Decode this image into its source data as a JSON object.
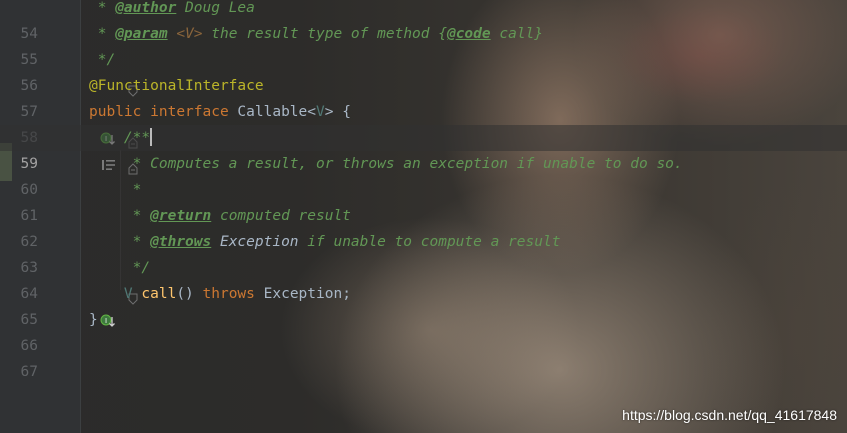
{
  "editor": {
    "lines": [
      {
        "number": "54",
        "indent": " ",
        "parts": {
          "p1": "* ",
          "p2": "@author",
          "p3": " Doug Lea"
        }
      },
      {
        "number": "55",
        "indent": " ",
        "parts": {
          "p1": "* ",
          "p2": "@param",
          "p3": " ",
          "p4": "<V>",
          "p5": " the result type of method {",
          "p6": "@code",
          "p7": " call}"
        }
      },
      {
        "number": "56",
        "indent": " ",
        "parts": {
          "p1": "*/"
        }
      },
      {
        "number": "57",
        "parts": {
          "p1": "@FunctionalInterface"
        }
      },
      {
        "number": "58",
        "parts": {
          "p1": "public",
          "p2": " ",
          "p3": "interface",
          "p4": " Callable<",
          "p5": "V",
          "p6": "> {"
        }
      },
      {
        "number": "59",
        "indent": "    ",
        "parts": {
          "p1": "/**"
        }
      },
      {
        "number": "60",
        "indent": "     ",
        "parts": {
          "p1": "* Computes a result, or throws an exception if unable to do so."
        }
      },
      {
        "number": "61",
        "indent": "     ",
        "parts": {
          "p1": "*"
        }
      },
      {
        "number": "62",
        "indent": "     ",
        "parts": {
          "p1": "* ",
          "p2": "@return",
          "p3": " computed result"
        }
      },
      {
        "number": "63",
        "indent": "     ",
        "parts": {
          "p1": "* ",
          "p2": "@throws",
          "p3": " ",
          "p4": "Exception",
          "p5": " if unable to compute a result"
        }
      },
      {
        "number": "64",
        "indent": "     ",
        "parts": {
          "p1": "*/"
        }
      },
      {
        "number": "65",
        "indent": "    ",
        "parts": {
          "p1": "V",
          "p2": " ",
          "p3": "call",
          "p4": "() ",
          "p5": "throws",
          "p6": " Exception;"
        }
      },
      {
        "number": "66",
        "parts": {
          "p1": "}"
        }
      },
      {
        "number": "67",
        "parts": {}
      }
    ],
    "current_line": "59",
    "gutter_icons": {
      "line58": "implemented-interface-icon",
      "line59": "rendered-doc-toggle-icon",
      "line65": "implemented-method-icon"
    }
  },
  "watermark": "https://blog.csdn.net/qq_41617848",
  "colors": {
    "background": "#2b2b2b",
    "gutter": "#313335",
    "line_number": "#606366",
    "javadoc": "#629755",
    "keyword": "#cc7832",
    "annotation": "#bbb529",
    "plain": "#a9b7c6",
    "type_param": "#507874",
    "method": "#ffc66d"
  }
}
